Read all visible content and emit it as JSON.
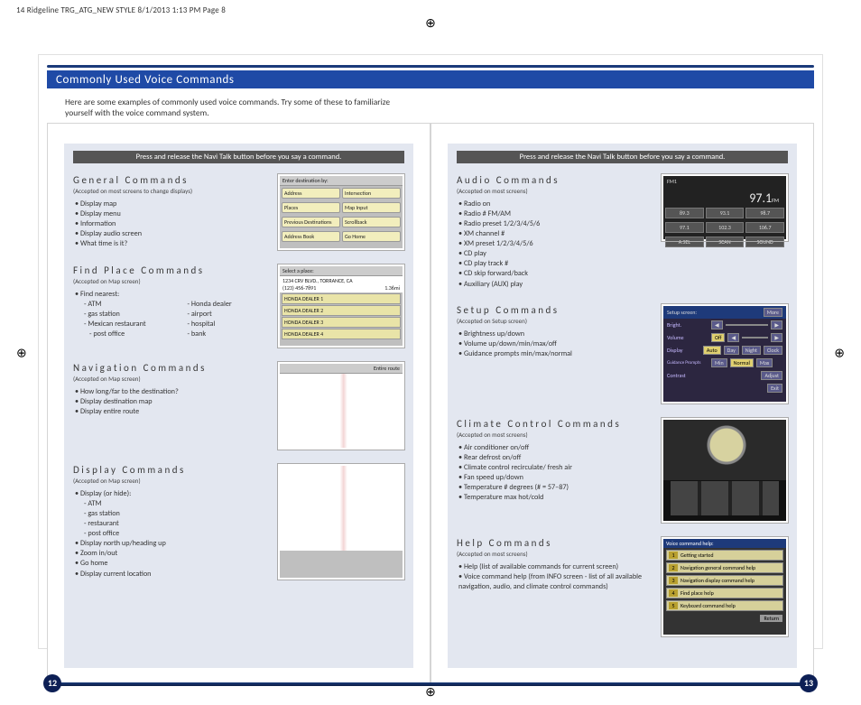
{
  "print_header": "14 Ridgeline TRG_ATG_NEW STYLE  8/1/2013  1:13 PM  Page 8",
  "page_title": "Commonly Used Voice Commands",
  "intro": "Here are some examples of commonly used voice commands. Try some of these to familiarize yourself with the voice command system.",
  "instruction": "Press and release the Navi Talk button before you say a command.",
  "page_numbers": {
    "left": "12",
    "right": "13"
  },
  "left": {
    "general": {
      "hdr": "General Commands",
      "sub": "(Accepted on most screens to change displays)",
      "items": [
        "Display map",
        "Display menu",
        "Information",
        "Display audio screen",
        "What time is it?"
      ],
      "screen": {
        "title": "Enter destination by:",
        "buttons": [
          "Address",
          "Intersection",
          "Places",
          "Map Input",
          "Previous Destinations",
          "Scrollback",
          "Address Book",
          "Go Home"
        ]
      }
    },
    "findplace": {
      "hdr": "Find Place Commands",
      "sub": "(Accepted on Map screen)",
      "lead": "Find nearest:",
      "col1": [
        "ATM",
        "gas station",
        "Mexican restaurant",
        "post office"
      ],
      "col2": [
        "Honda dealer",
        "airport",
        "hospital",
        "bank"
      ],
      "screen": {
        "title": "Select a place:",
        "addr": "1234 CRV BLVD., TORRANCE, CA",
        "phone": "(123) 456-7891",
        "dist": "1.36mi",
        "rows": [
          "HONDA DEALER 1",
          "HONDA DEALER 2",
          "HONDA DEALER 3",
          "HONDA DEALER 4"
        ]
      }
    },
    "nav": {
      "hdr": "Navigation Commands",
      "sub": "(Accepted on Map screen)",
      "items": [
        "How long/far to the destination?",
        "Display destination map",
        "Display entire route"
      ],
      "screen_label": "Entire route"
    },
    "display": {
      "hdr": "Display Commands",
      "sub": "(Accepted on Map screen)",
      "lead": "Display (or hide):",
      "sub_items": [
        "ATM",
        "gas station",
        "restaurant",
        "post office"
      ],
      "items2": [
        "Display north up/heading up",
        "Zoom in/out",
        "Go home",
        "Display current location"
      ]
    }
  },
  "right": {
    "audio": {
      "hdr": "Audio Commands",
      "sub": "(Accepted on most screens)",
      "items": [
        "Radio on",
        "Radio # FM/AM",
        "Radio preset 1/2/3/4/5/6",
        "XM channel #",
        "XM preset 1/2/3/4/5/6",
        "CD play",
        "CD play track #",
        "CD skip forward/back",
        "Auxiliary (AUX) play"
      ],
      "screen": {
        "band": "FM1",
        "freq": "97.1",
        "unit": "FM",
        "presets_row1": [
          "89.3",
          "93.1",
          "98.7"
        ],
        "presets_row2": [
          "97.1",
          "102.3",
          "106.7"
        ],
        "buttons": [
          "A.SEL",
          "SCAN",
          "SOUND"
        ]
      }
    },
    "setup": {
      "hdr": "Setup Commands",
      "sub": "(Accepted on Setup screen)",
      "items": [
        "Brightness up/down",
        "Volume up/down/min/max/off",
        "Guidance prompts min/max/normal"
      ],
      "screen": {
        "title": "Setup screen:",
        "more": "More",
        "rows": [
          {
            "lbl": "Bright.",
            "opts": [
              "◀",
              "",
              "▶"
            ]
          },
          {
            "lbl": "Volume",
            "opts": [
              "Off",
              "◀",
              "",
              "▶"
            ],
            "hi": 0
          },
          {
            "lbl": "Display",
            "opts": [
              "Auto",
              "Day",
              "Night",
              "Clock"
            ],
            "hi": 0
          },
          {
            "lbl": "Guidance Prompts",
            "opts": [
              "Min",
              "Normal",
              "Max"
            ],
            "hi": 1
          },
          {
            "lbl": "Contrast",
            "opts": [
              "Adjust"
            ]
          }
        ],
        "exit": "Exit"
      }
    },
    "climate": {
      "hdr": "Climate Control Commands",
      "sub": "(Accepted on most screens)",
      "items": [
        "Air conditioner on/off",
        "Rear defrost on/off",
        "Climate control recirculate/ fresh air",
        "Fan speed up/down",
        "Temperature # degrees (# = 57–87)",
        "Temperature max hot/cold"
      ]
    },
    "help": {
      "hdr": "Help Commands",
      "sub": "(Accepted on most screens)",
      "items": [
        "Help (list of available commands for current screen)",
        "Voice command help (from INFO screen - list of all available navigation, audio, and climate control commands)"
      ],
      "screen": {
        "title": "Voice command help:",
        "rows": [
          "Getting started",
          "Navigation general command help",
          "Navigation display command help",
          "Find place help",
          "Keyboard command help"
        ],
        "return": "Return"
      }
    }
  }
}
